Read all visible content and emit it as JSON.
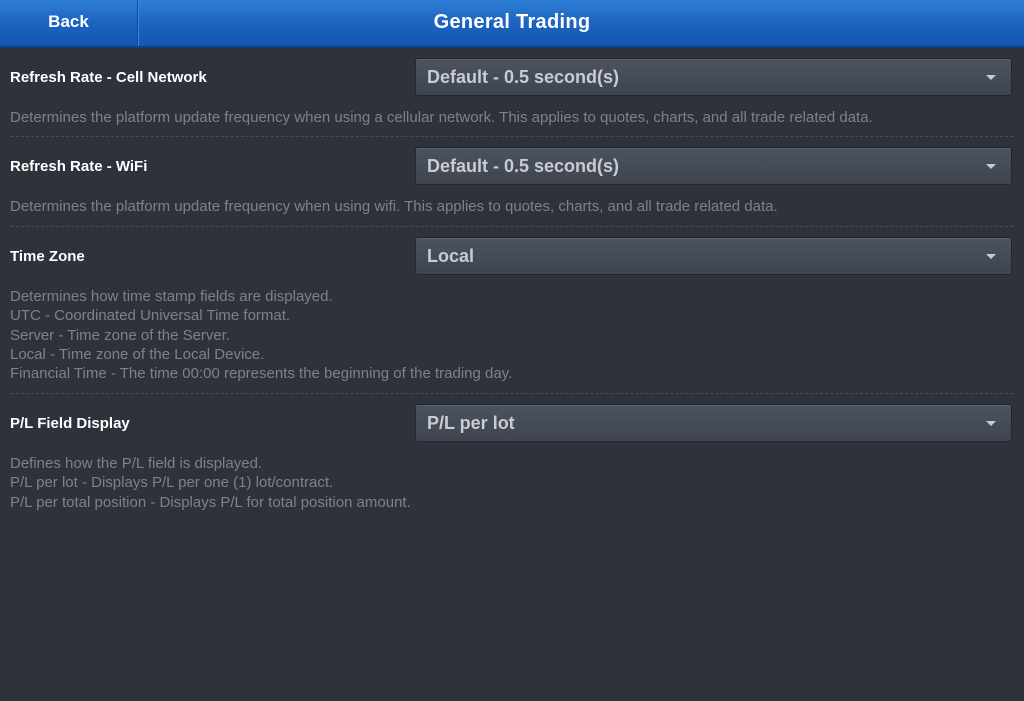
{
  "header": {
    "back_label": "Back",
    "title": "General Trading"
  },
  "settings": [
    {
      "label": "Refresh Rate - Cell Network",
      "value": "Default - 0.5 second(s)",
      "description": [
        "Determines the platform update frequency when using a cellular network. This applies to quotes, charts, and all trade related data."
      ]
    },
    {
      "label": "Refresh Rate - WiFi",
      "value": "Default - 0.5 second(s)",
      "description": [
        "Determines the platform update frequency when using wifi. This applies to quotes, charts, and all trade related data."
      ]
    },
    {
      "label": "Time Zone",
      "value": "Local",
      "description": [
        "Determines how time stamp fields are displayed.",
        "UTC - Coordinated Universal Time format.",
        "Server - Time zone of the Server.",
        "Local - Time zone of the Local Device.",
        "Financial Time - The time 00:00 represents the beginning of the trading day."
      ]
    },
    {
      "label": "P/L Field Display",
      "value": "P/L per lot",
      "description": [
        "Defines how the P/L field is displayed.",
        "P/L per lot - Displays P/L per one (1) lot/contract.",
        "P/L per total position - Displays P/L for total position amount."
      ]
    }
  ]
}
